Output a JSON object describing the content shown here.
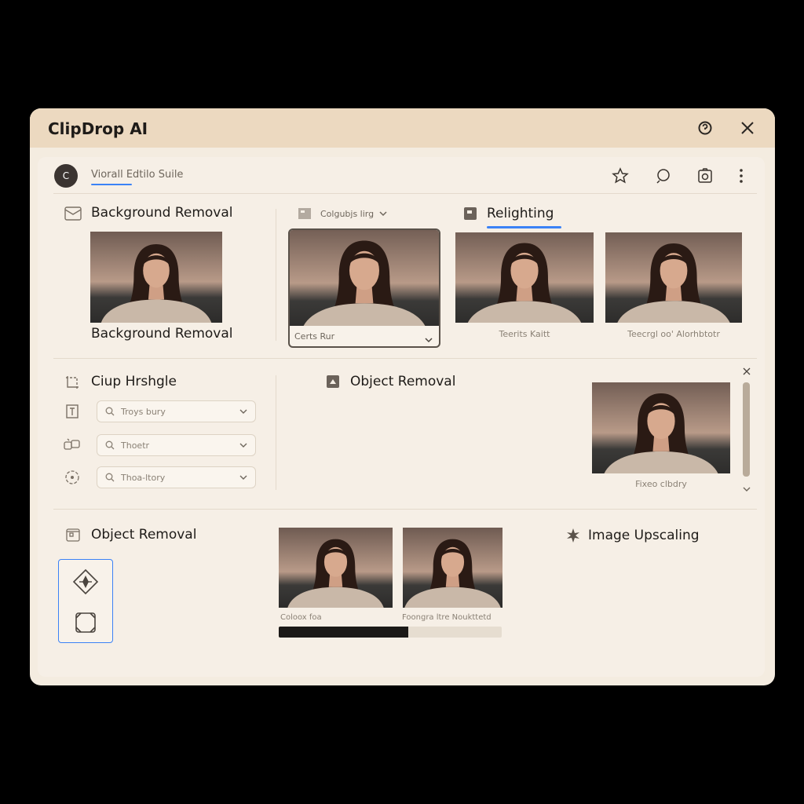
{
  "window": {
    "title": "ClipDrop AI"
  },
  "titlebar_icons": [
    "help-icon",
    "close-icon"
  ],
  "toolbar": {
    "suite_label": "Viorall Edtilo Suile",
    "logo_glyph": "C",
    "icons": [
      "star-icon",
      "search-icon",
      "camera-icon",
      "more-icon"
    ]
  },
  "top_section": {
    "background_removal": {
      "title": "Background Removal",
      "caption": "Background Removal"
    },
    "middle": {
      "dropdown_label": "Colgubjs lirg",
      "card_caption": "Certs Rur"
    },
    "relighting": {
      "title": "Relighting",
      "caption_1": "Teerits Kaitt",
      "caption_2": "Teecrgl oo' Alorhbtotr"
    }
  },
  "middle_section": {
    "clip_title": "Ciup Hrshgle",
    "dropdowns": [
      {
        "value": "Troys bury"
      },
      {
        "value": "Thoetr"
      },
      {
        "value": "Thoa-ltory"
      }
    ],
    "object_removal_title": "Object Removal",
    "preview_caption": "Fixeo clbdry"
  },
  "bottom_section": {
    "object_removal_title": "Object Removal",
    "caption_1": "Coloox foa",
    "caption_2": "Foongra ltre Noukttetd",
    "progress": 0.58,
    "image_upscaling_title": "Image Upscaling"
  },
  "colors": {
    "accent": "#3b82f6",
    "titlebar": "#ecd9c0",
    "panel": "#f6efe6"
  }
}
